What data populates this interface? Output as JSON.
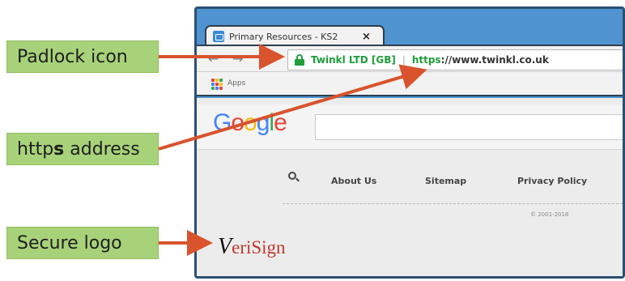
{
  "browser": {
    "tab": {
      "title": "Primary Resources - KS2",
      "close_glyph": "×"
    },
    "nav": {
      "back": "←",
      "forward": "→",
      "reload": "↻"
    },
    "omnibox": {
      "ev_name": "Twinkl LTD [GB]",
      "separator": "|",
      "scheme": "https",
      "rest": "://www.twinkl.co.uk"
    },
    "bookmarks": {
      "apps_label": "Apps"
    }
  },
  "page": {
    "google": {
      "letters": [
        "G",
        "o",
        "o",
        "g",
        "l",
        "e"
      ],
      "colors": [
        "#4285f4",
        "#ea4335",
        "#fbbc05",
        "#4285f4",
        "#34a853",
        "#ea4335"
      ]
    },
    "footer_links": [
      "About Us",
      "Sitemap",
      "Privacy Policy"
    ],
    "copyright": "© 2001-2018",
    "verisign": {
      "check": "V",
      "text": "eriSign"
    }
  },
  "callouts": [
    {
      "label": "Padlock icon"
    },
    {
      "label": "https address",
      "bold_part": "s"
    },
    {
      "label": "Secure logo"
    }
  ],
  "colors": {
    "arrow": "#d9532c",
    "callout_bg": "#a8d279",
    "secure_green": "#1f9d3a",
    "frame_blue": "#4f93d0"
  }
}
